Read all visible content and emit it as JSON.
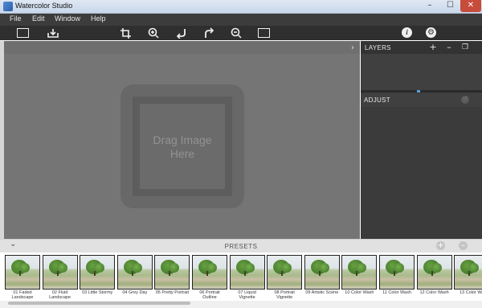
{
  "window": {
    "title": "Watercolor Studio",
    "controls": {
      "minimize": "–",
      "maximize": "☐",
      "close": "✕"
    }
  },
  "menu": {
    "items": [
      "File",
      "Edit",
      "Window",
      "Help"
    ]
  },
  "toolbar": {
    "icons": [
      "open-image-icon",
      "save-icon",
      "crop-icon",
      "zoom-in-icon",
      "undo-icon",
      "redo-icon",
      "zoom-out-icon",
      "fit-screen-icon",
      "info-icon",
      "settings-icon"
    ],
    "info_glyph": "i",
    "settings_glyph": "⚙"
  },
  "canvas": {
    "drop_text_line1": "Drag Image",
    "drop_text_line2": "Here",
    "collapse_glyph": "›"
  },
  "layers": {
    "title": "LAYERS",
    "add": "+",
    "remove": "–",
    "duplicate": "❐"
  },
  "adjust": {
    "title": "ADJUST"
  },
  "presets": {
    "title": "PRESETS",
    "toggle_glyph": "⌄",
    "add": "+",
    "remove": "–",
    "items": [
      {
        "line1": "01 Faded",
        "line2": "Landscape"
      },
      {
        "line1": "02 Fluid",
        "line2": "Landscape"
      },
      {
        "line1": "03 Little Stormy",
        "line2": ""
      },
      {
        "line1": "04 Grey Day",
        "line2": ""
      },
      {
        "line1": "05 Pretty Portrait",
        "line2": ""
      },
      {
        "line1": "06 Portrait",
        "line2": "Outline"
      },
      {
        "line1": "07 Liquid",
        "line2": "Vignette"
      },
      {
        "line1": "08 Portrait",
        "line2": "Vignette"
      },
      {
        "line1": "09 Artistic Scene",
        "line2": ""
      },
      {
        "line1": "10 Color Wash",
        "line2": ""
      },
      {
        "line1": "11 Color Wash",
        "line2": ""
      },
      {
        "line1": "12 Color Wash",
        "line2": ""
      },
      {
        "line1": "13 Color Wa",
        "line2": ""
      }
    ]
  },
  "colors": {
    "menubar": "#3c3c3c",
    "toolbar": "#2f2f2f",
    "canvas": "#757575",
    "panel": "#3c3c3c",
    "accent": "#5aa0d6"
  }
}
